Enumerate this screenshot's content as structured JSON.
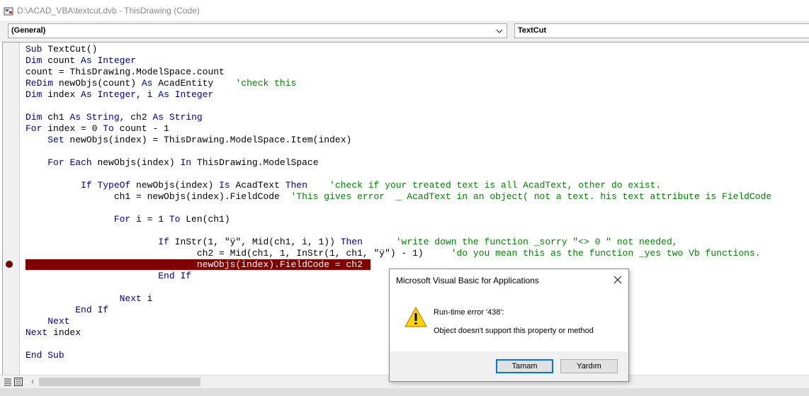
{
  "window": {
    "title": "D:\\ACAD_VBA\\textcut.dvb - ThisDrawing (Code)"
  },
  "combos": {
    "object": "(General)",
    "procedure": "TextCut"
  },
  "code_lines": [
    [
      {
        "t": "Sub TextCut()",
        "c": ""
      }
    ],
    [
      {
        "t": "Dim count As Integer",
        "c": ""
      }
    ],
    [
      {
        "t": "count = ThisDrawing.ModelSpace.count",
        "c": ""
      }
    ],
    [
      {
        "t": "ReDim newObjs(count) As AcadEntity    ",
        "c": ""
      },
      {
        "t": "'check this",
        "c": "cm"
      }
    ],
    [
      {
        "t": "Dim index As Integer, i As Integer",
        "c": ""
      }
    ],
    [
      {
        "t": "",
        "c": ""
      }
    ],
    [
      {
        "t": "Dim ch1 As String, ch2 As String",
        "c": ""
      }
    ],
    [
      {
        "t": "For index = 0 To count - 1",
        "c": ""
      }
    ],
    [
      {
        "t": "    Set newObjs(index) = ThisDrawing.ModelSpace.Item(index)",
        "c": ""
      }
    ],
    [
      {
        "t": "",
        "c": ""
      }
    ],
    [
      {
        "t": "    For Each newObjs(index) In ThisDrawing.ModelSpace",
        "c": ""
      }
    ],
    [
      {
        "t": "",
        "c": ""
      }
    ],
    [
      {
        "t": "          If TypeOf newObjs(index) Is AcadText Then    ",
        "c": ""
      },
      {
        "t": "'check if your treated text is all AcadText, other do exist.",
        "c": "cm"
      }
    ],
    [
      {
        "t": "                ch1 = newObjs(index).FieldCode  ",
        "c": ""
      },
      {
        "t": "'This gives error  _ AcadText in an object( not a text. his text attribute is FieldCode",
        "c": "cm"
      }
    ],
    [
      {
        "t": "",
        "c": ""
      }
    ],
    [
      {
        "t": "                For i = 1 To Len(ch1)",
        "c": ""
      }
    ],
    [
      {
        "t": "",
        "c": ""
      }
    ],
    [
      {
        "t": "                        If InStr(1, \"ÿ\", Mid(ch1, i, 1)) Then      ",
        "c": ""
      },
      {
        "t": "'write down the function _sorry \"<> 0 \" not needed,",
        "c": "cm"
      }
    ],
    [
      {
        "t": "                               ch2 = Mid(ch1, 1, InStr(1, ch1, \"ÿ\") - 1)     ",
        "c": ""
      },
      {
        "t": "'do you mean this as the function _yes two Vb functions.",
        "c": "cm"
      }
    ],
    [
      {
        "t": "                               newObjs(index).FieldCode = ch2",
        "c": "hl"
      }
    ],
    [
      {
        "t": "                        End If",
        "c": ""
      }
    ],
    [
      {
        "t": "",
        "c": ""
      }
    ],
    [
      {
        "t": "                 Next i",
        "c": ""
      }
    ],
    [
      {
        "t": "         End If",
        "c": ""
      }
    ],
    [
      {
        "t": "    Next",
        "c": ""
      }
    ],
    [
      {
        "t": "Next index",
        "c": ""
      }
    ],
    [
      {
        "t": "",
        "c": ""
      }
    ],
    [
      {
        "t": "End Sub",
        "c": ""
      }
    ]
  ],
  "dialog": {
    "title": "Microsoft Visual Basic for Applications",
    "error_line1": "Run-time error '438':",
    "error_line2": "Object doesn't support this property or method",
    "ok_label": "Tamam",
    "help_label": "Yardım"
  },
  "colors": {
    "keyword": "#00008b",
    "comment": "#008000",
    "breakpoint": "#800000",
    "focus_border": "#0078d7"
  },
  "icons": {
    "app": "vba-app-icon",
    "combo_arrow": "chevron-down-icon",
    "close": "close-icon",
    "warning": "warning-icon",
    "breakpoint": "breakpoint-dot-icon",
    "scroll_left": "chevron-left-icon"
  }
}
